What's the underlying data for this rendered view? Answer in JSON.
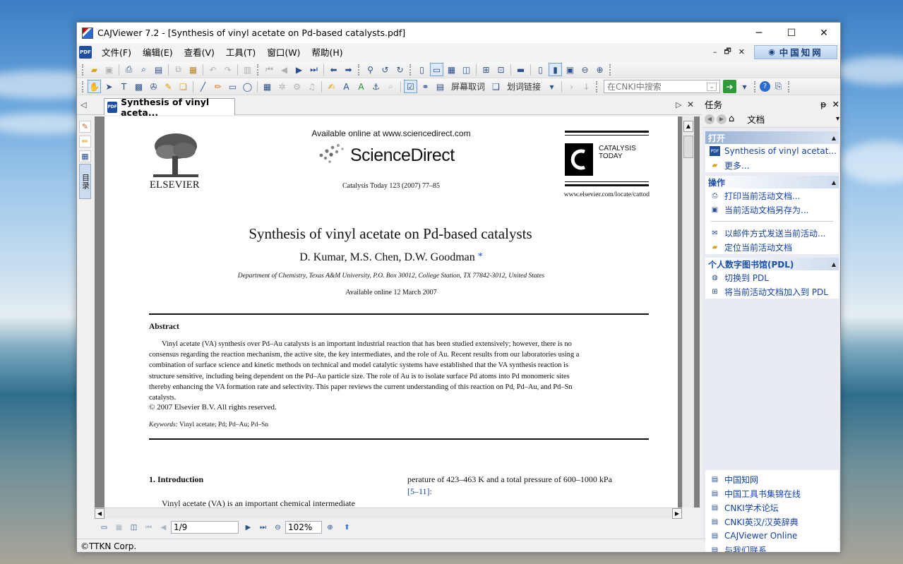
{
  "window": {
    "title": "CAJViewer 7.2 - [Synthesis of vinyl acetate on Pd-based catalysts.pdf]",
    "minimize": "─",
    "maximize": "☐",
    "close": "✕"
  },
  "menu": {
    "items": [
      "文件(F)",
      "编辑(E)",
      "查看(V)",
      "工具(T)",
      "窗口(W)",
      "帮助(H)"
    ],
    "mdi_min": "–",
    "mdi_restore": "🗗",
    "mdi_close": "✕",
    "cnki_logo": "中国知网"
  },
  "toolbar2": {
    "screen_ocr": "屏幕取词",
    "word_link": "划词链接",
    "search_placeholder": "在CNKI中搜索",
    "dropdown": "▾"
  },
  "tab": {
    "label": "Synthesis of vinyl aceta...",
    "nav_left": "◁",
    "nav_right": "▷",
    "close": "✕"
  },
  "leftstrip": {
    "tab_label": "目录"
  },
  "document": {
    "publisher": "ELSEVIER",
    "available_online": "Available online at www.sciencedirect.com",
    "sciencedirect": "ScienceDirect",
    "citation": "Catalysis Today 123 (2007) 77–85",
    "journal_logo": "CATALYSIS TODAY",
    "journal_url": "www.elsevier.com/locate/cattod",
    "title": "Synthesis of vinyl acetate on Pd-based catalysts",
    "authors": "D. Kumar, M.S. Chen, D.W. Goodman",
    "author_mark": "*",
    "affiliation": "Department of Chemistry, Texas A&M University, P.O. Box 30012, College Station, TX 77842-3012, United States",
    "available_date": "Available online 12 March 2007",
    "abstract_heading": "Abstract",
    "abstract_lines": [
      "Vinyl acetate (VA) synthesis over Pd–Au catalysts is an important industrial reaction that has been studied extensively; however, there is no",
      "consensus regarding the reaction mechanism, the active site, the key intermediates, and the role of Au. Recent results from our laboratories using a",
      "combination of surface science and kinetic methods on technical and model catalytic systems have established that the VA synthesis reaction is",
      "structure sensitive, including being dependent on the Pd–Au particle size. The role of Au is to isolate surface Pd atoms into Pd monomeric sites",
      "thereby enhancing the VA formation rate and selectivity. This paper reviews the current understanding of this reaction on Pd, Pd–Au, and Pd–Sn",
      "catalysts."
    ],
    "copyright": "© 2007 Elsevier B.V. All rights reserved.",
    "keywords_label": "Keywords:",
    "keywords": "Vinyl acetate; Pd; Pd–Au; Pd–Sn",
    "section1": "1. Introduction",
    "intro_line": "Vinyl acetate (VA) is an important chemical intermediate",
    "right_col_line": "perature of 423–463 K and a total pressure of 600–1000 kPa",
    "right_col_ref": "[5–11]:"
  },
  "status": {
    "page": "1/9",
    "zoom": "102%"
  },
  "footer": {
    "copyright": "©TTKN Corp."
  },
  "taskpane": {
    "title": "任务",
    "pin": "ᵽ",
    "close": "✕",
    "nav_label": "文档",
    "nav_dropdown": "▾",
    "collapse": "▲",
    "sections": {
      "open": {
        "title": "打开",
        "items": [
          "Synthesis of vinyl acetat...",
          "更多..."
        ]
      },
      "ops": {
        "title": "操作",
        "items": [
          "打印当前活动文档...",
          "当前活动文档另存为...",
          "以邮件方式发送当前活动...",
          "定位当前活动文档"
        ]
      },
      "pdl": {
        "title": "个人数字图书馆(PDL)",
        "items": [
          "切换到 PDL",
          "将当前活动文档加入到 PDL"
        ]
      }
    },
    "links": [
      "中国知网",
      "中国工具书集锦在线",
      "CNKI学术论坛",
      "CNKI英汉/汉英辞典",
      "CAJViewer Online",
      "与我们联系"
    ]
  }
}
